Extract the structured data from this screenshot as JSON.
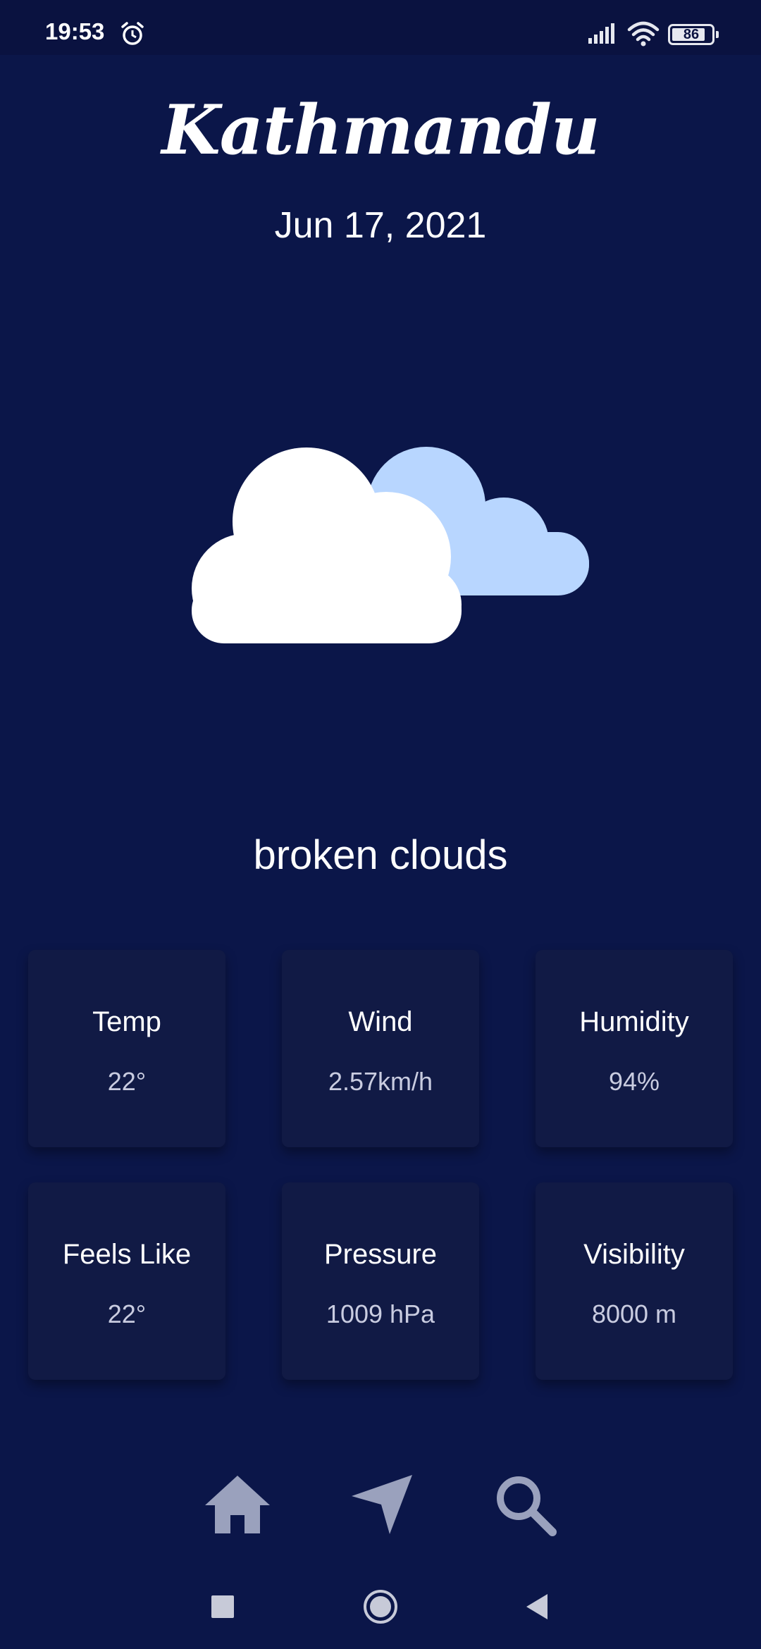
{
  "status_bar": {
    "time": "19:53",
    "battery": "86"
  },
  "header": {
    "city": "Kathmandu",
    "date": "Jun 17, 2021"
  },
  "weather": {
    "icon": "broken-clouds-icon",
    "condition": "broken clouds"
  },
  "stats": [
    {
      "label": "Temp",
      "value": "22°"
    },
    {
      "label": "Wind",
      "value": "2.57km/h"
    },
    {
      "label": "Humidity",
      "value": "94%"
    },
    {
      "label": "Feels Like",
      "value": "22°"
    },
    {
      "label": "Pressure",
      "value": "1009 hPa"
    },
    {
      "label": "Visibility",
      "value": "8000 m"
    }
  ],
  "bottom_nav": {
    "items": [
      {
        "icon": "home-icon"
      },
      {
        "icon": "location-arrow-icon"
      },
      {
        "icon": "search-icon"
      }
    ]
  },
  "system_nav": {
    "items": [
      "recents-icon",
      "home-circle-icon",
      "back-icon"
    ]
  },
  "colors": {
    "background": "#0b1649",
    "card": "#111a45",
    "cloud_front": "#ffffff",
    "cloud_back": "#b8d6ff",
    "nav_icon": "#9aa1bd"
  }
}
